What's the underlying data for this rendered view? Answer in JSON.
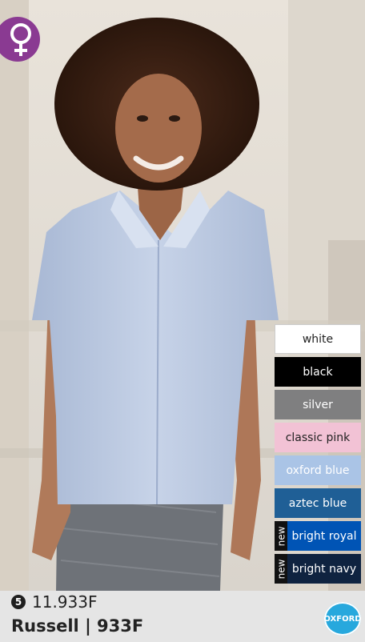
{
  "swatches": [
    {
      "name": "white",
      "bg": "#ffffff",
      "fg": "#222222",
      "border": "#cccccc",
      "new": false
    },
    {
      "name": "black",
      "bg": "#000000",
      "fg": "#ffffff",
      "border": "#000000",
      "new": false
    },
    {
      "name": "silver",
      "bg": "#7f7f80",
      "fg": "#ffffff",
      "border": "#7f7f80",
      "new": false
    },
    {
      "name": "classic pink",
      "bg": "#f2c2d5",
      "fg": "#222222",
      "border": "#f2c2d5",
      "new": false
    },
    {
      "name": "oxford blue",
      "bg": "#aac4e6",
      "fg": "#ffffff",
      "border": "#aac4e6",
      "new": false
    },
    {
      "name": "aztec blue",
      "bg": "#1f5f96",
      "fg": "#ffffff",
      "border": "#1f5f96",
      "new": false
    },
    {
      "name": "bright royal",
      "bg": "#0054b5",
      "fg": "#ffffff",
      "border": "#0054b5",
      "new": true
    },
    {
      "name": "bright navy",
      "bg": "#0f2340",
      "fg": "#ffffff",
      "border": "#0f2340",
      "new": true
    }
  ],
  "new_label": "new",
  "product": {
    "badge_number": "5",
    "sku": "11.933F",
    "title": "Russell | 933F",
    "oxford_badge": "OXFORD"
  },
  "colors": {
    "gender_badge": "#8a3a92",
    "oxford_badge": "#27a8dd"
  },
  "icons": {
    "gender": "female-symbol-icon",
    "fabric": "oxford-icon"
  }
}
